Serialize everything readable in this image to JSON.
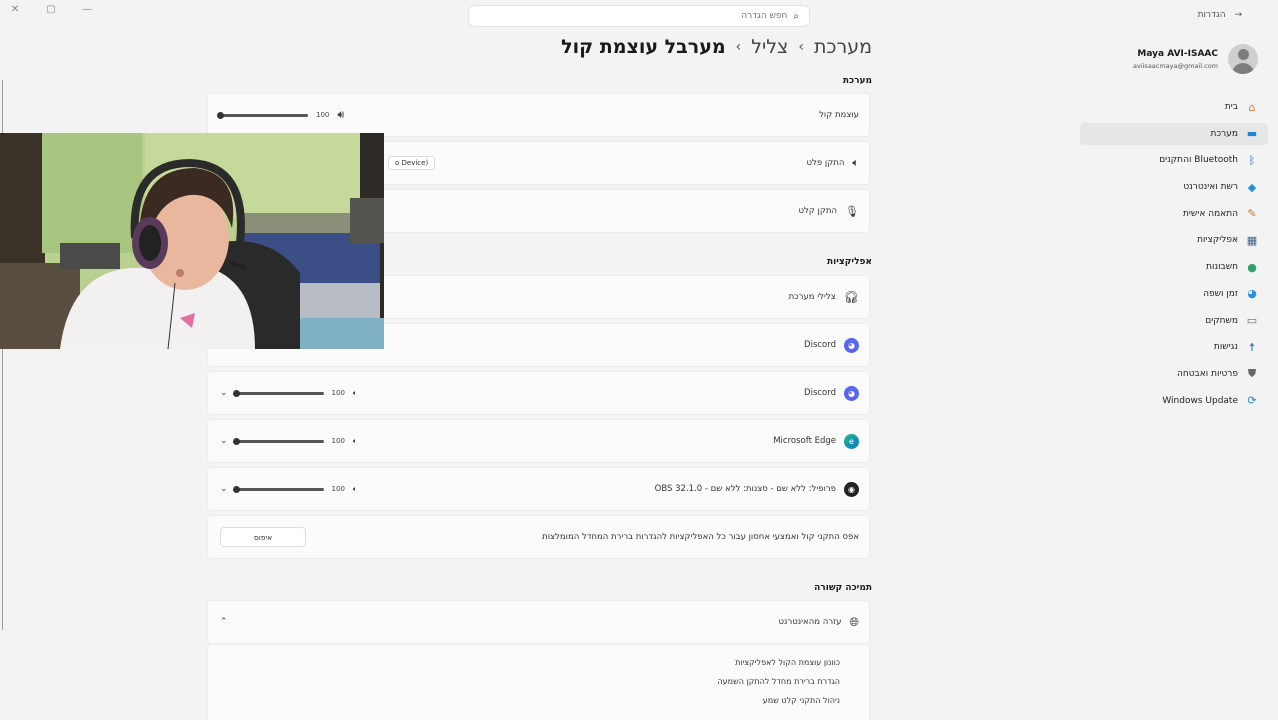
{
  "window": {
    "controls": [
      "✕",
      "▢",
      "—"
    ]
  },
  "search": {
    "placeholder": "חפש הגדרה"
  },
  "back_label": "הגדרות",
  "profile": {
    "name": "Maya AVI-ISAAC",
    "email": "aviisaacmaya@gmail.com"
  },
  "nav": [
    {
      "label": "בית",
      "icon": "home-icon"
    },
    {
      "label": "מערכת",
      "icon": "system-icon",
      "active": true
    },
    {
      "label": "Bluetooth והתקנים",
      "icon": "bluetooth-icon"
    },
    {
      "label": "רשת ואינטרנט",
      "icon": "network-icon"
    },
    {
      "label": "התאמה אישית",
      "icon": "personalization-icon"
    },
    {
      "label": "אפליקציות",
      "icon": "apps-icon"
    },
    {
      "label": "חשבונות",
      "icon": "accounts-icon"
    },
    {
      "label": "זמן ושפה",
      "icon": "time-language-icon"
    },
    {
      "label": "משחקים",
      "icon": "gaming-icon"
    },
    {
      "label": "נגישות",
      "icon": "accessibility-icon"
    },
    {
      "label": "פרטיות ואבטחה",
      "icon": "privacy-shield-icon"
    },
    {
      "label": "Windows Update",
      "icon": "windows-update-icon"
    }
  ],
  "breadcrumb": {
    "part1": "מערכת",
    "part2": "צליל",
    "current": "מערבל עוצמת קול"
  },
  "sections": {
    "system": "מערכת",
    "apps": "אפליקציות",
    "support": "תמיכה קשורה"
  },
  "system_rows": {
    "volume_label": "עוצמת קול",
    "volume_value": "100",
    "volume_level": 1.0,
    "output_label": "התקן פלט",
    "output_device": "o Device)",
    "input_label": "התקן קלט"
  },
  "apps": [
    {
      "label": "צלילי מערכת",
      "icon": "headphones-icon"
    },
    {
      "label": "Discord",
      "icon": "discord-icon"
    },
    {
      "label": "Discord",
      "icon": "discord-icon",
      "value": "100",
      "level": 1.0
    },
    {
      "label": "Microsoft Edge",
      "icon": "edge-icon",
      "value": "100",
      "level": 1.0
    },
    {
      "label": "פרופיל: ללא שם - סצנות: ללא שם - OBS 32.1.0",
      "icon": "obs-icon",
      "value": "100",
      "level": 1.0
    }
  ],
  "reset": {
    "text": "אפס התקני קול ואמצעי אחסון עבור כל האפליקציות להגדרות ברירת המחדל המומלצות",
    "button": "איפוס"
  },
  "support": {
    "header": "עזרה מהאינטרנט",
    "links": [
      "כוונון עוצמת הקול לאפליקציות",
      "הגדרת ברירת מחדל להתקן השמעה",
      "ניהול התקני קלט שמע"
    ]
  }
}
